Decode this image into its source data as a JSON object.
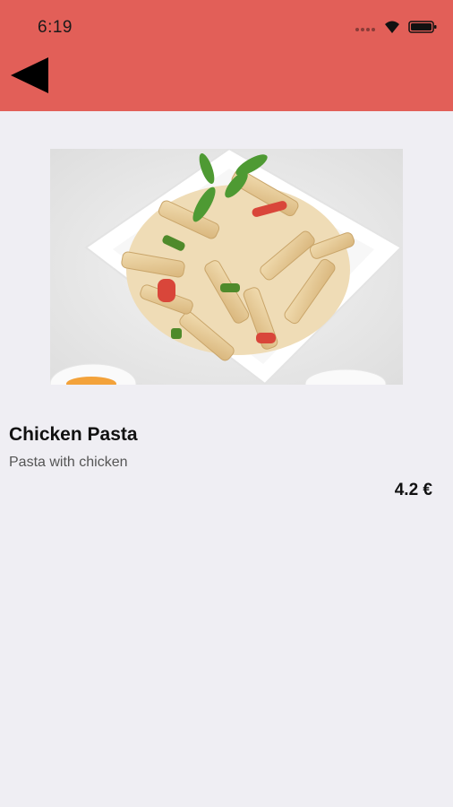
{
  "status_bar": {
    "time": "6:19"
  },
  "header": {
    "background_color": "#e25f58",
    "back_icon": "back-triangle-icon"
  },
  "product": {
    "image_alt": "Chicken Pasta image",
    "name": "Chicken Pasta",
    "description": "Pasta with chicken",
    "price": "4.2 €"
  },
  "colors": {
    "page_background": "#efeef3"
  }
}
